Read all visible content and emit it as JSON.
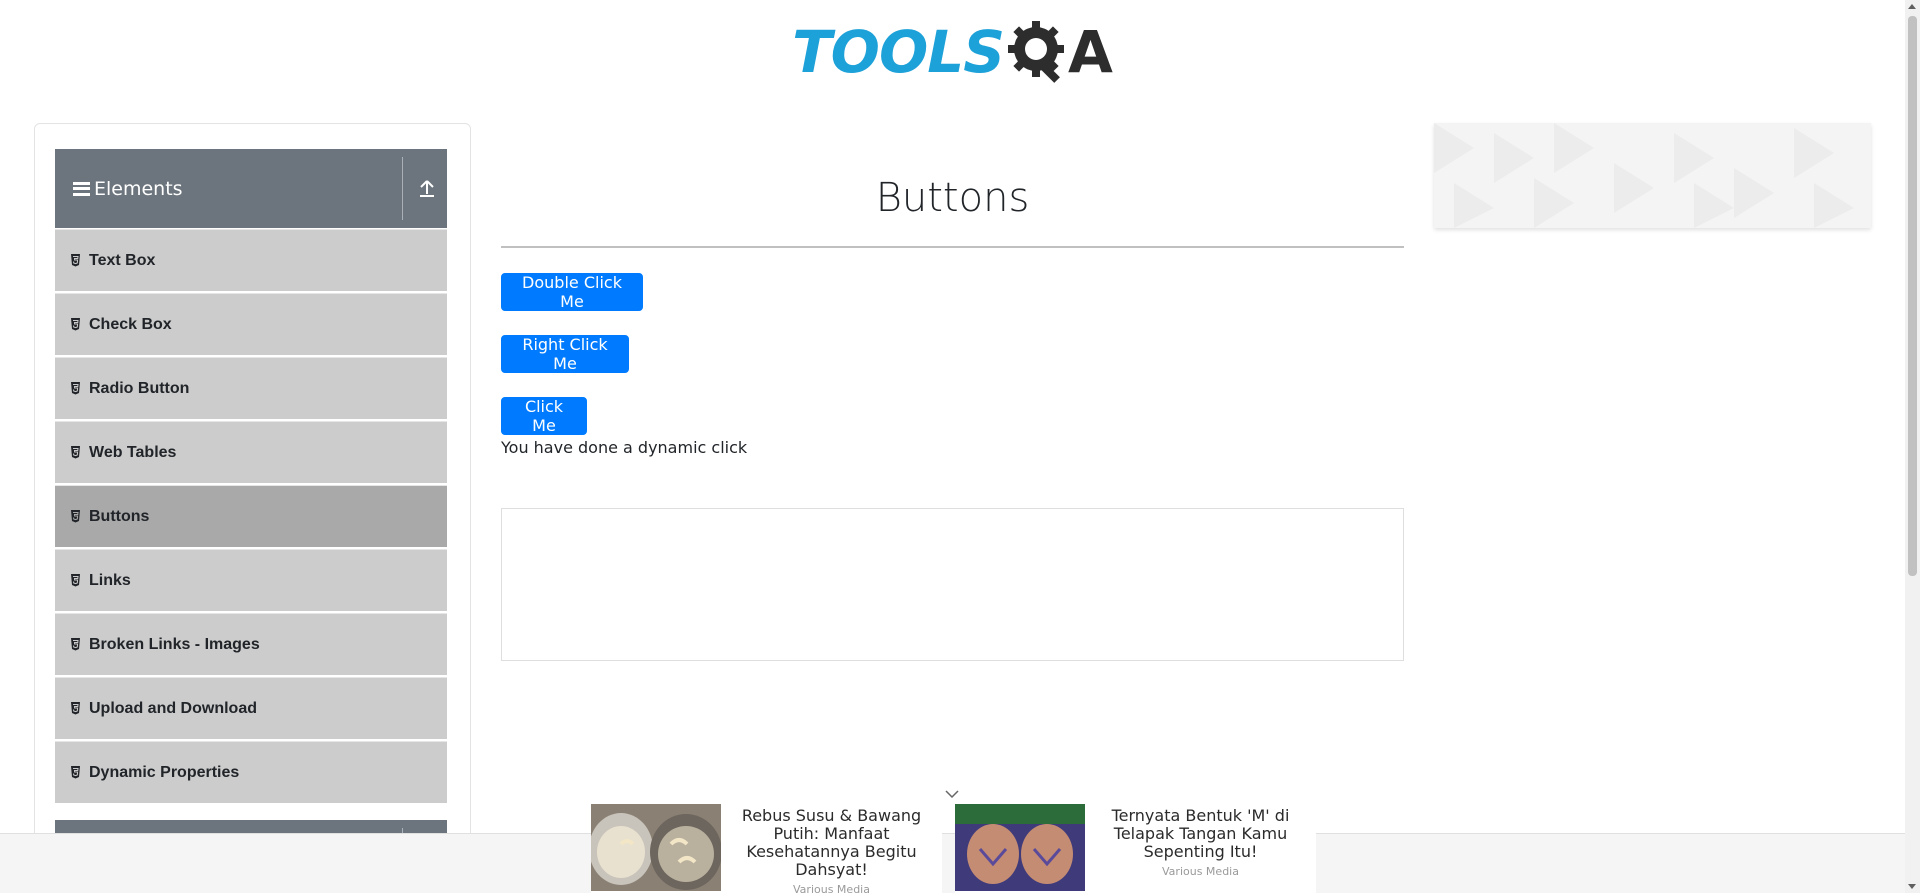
{
  "logo": {
    "tools_text": "TOOLS",
    "qa_text": "A",
    "colors": {
      "tools": "#1da1d9",
      "gear": "#2d2d2d"
    }
  },
  "sidebar": {
    "group_title": "Elements",
    "items": [
      {
        "label": "Text Box",
        "active": false
      },
      {
        "label": "Check Box",
        "active": false
      },
      {
        "label": "Radio Button",
        "active": false
      },
      {
        "label": "Web Tables",
        "active": false
      },
      {
        "label": "Buttons",
        "active": true
      },
      {
        "label": "Links",
        "active": false
      },
      {
        "label": "Broken Links - Images",
        "active": false
      },
      {
        "label": "Upload and Download",
        "active": false
      },
      {
        "label": "Dynamic Properties",
        "active": false
      }
    ],
    "colors": {
      "header_bg": "#6c757d",
      "item_bg": "#cccccc",
      "active_bg": "#a9a9a9"
    }
  },
  "main": {
    "title": "Buttons",
    "double_click_label": "Double Click Me",
    "right_click_label": "Right Click Me",
    "click_label": "Click Me",
    "dynamic_message": "You have done a dynamic click",
    "button_color": "#007bff"
  },
  "bottom_ads": [
    {
      "headline": "Rebus Susu & Bawang Putih: Manfaat Kesehatannya Begitu Dahsyat!",
      "source": "Various Media"
    },
    {
      "headline": "Ternyata Bentuk 'M' di Telapak Tangan Kamu Sepenting Itu!",
      "source": "Various Media"
    }
  ]
}
